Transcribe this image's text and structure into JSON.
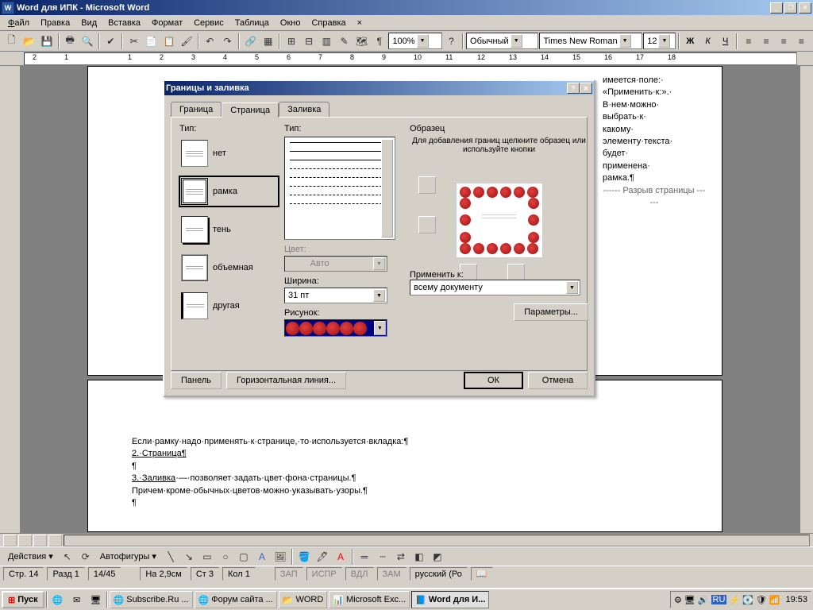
{
  "app": {
    "title": "Word для ИПК - Microsoft Word"
  },
  "menu": {
    "file": "Файл",
    "edit": "Правка",
    "view": "Вид",
    "insert": "Вставка",
    "format": "Формат",
    "tools": "Сервис",
    "table": "Таблица",
    "window": "Окно",
    "help": "Справка"
  },
  "toolbar": {
    "zoom": "100%",
    "style": "Обычный",
    "font": "Times New Roman",
    "size": "12",
    "bold": "Ж",
    "italic": "К",
    "underline": "Ч"
  },
  "ruler": {
    "marks": [
      "2",
      "1",
      "",
      "1",
      "2",
      "3",
      "4",
      "5",
      "6",
      "7",
      "8",
      "9",
      "10",
      "11",
      "12",
      "13",
      "14",
      "15",
      "16",
      "17",
      "18"
    ]
  },
  "doc": {
    "side": [
      "имеется·поле:·",
      "«Применить·к:».·",
      "В·нем·можно·",
      "выбрать·к·",
      "какому·",
      "элементу·текста·",
      "будет·",
      "применена·",
      "рамка.¶"
    ],
    "break": "Разрыв страницы",
    "body": [
      "Если·рамку·надо·применять·к·странице,·то·используется·вкладка:¶",
      "2.·Страница¶",
      "¶",
      "3.·Заливка·—·позволяет·задать·цвет·фона·страницы.¶",
      "Причем·кроме·обычных·цветов·можно·указывать·узоры.¶",
      "        ¶"
    ]
  },
  "dialog": {
    "title": "Границы и заливка",
    "tabs": {
      "border": "Граница",
      "page": "Страница",
      "fill": "Заливка"
    },
    "type_label": "Тип:",
    "types": {
      "none": "нет",
      "box": "рамка",
      "shadow": "тень",
      "threeD": "объемная",
      "custom": "другая"
    },
    "style_label": "Тип:",
    "color_label": "Цвет:",
    "color_value": "Авто",
    "width_label": "Ширина:",
    "width_value": "31 пт",
    "art_label": "Рисунок:",
    "preview_label": "Образец",
    "preview_hint": "Для добавления границ щелкните образец или используйте кнопки",
    "apply_label": "Применить к:",
    "apply_value": "всему документу",
    "options": "Параметры...",
    "panel": "Панель",
    "hline": "Горизонтальная линия...",
    "ok": "ОК",
    "cancel": "Отмена"
  },
  "draw": {
    "actions": "Действия",
    "autoshapes": "Автофигуры"
  },
  "status": {
    "page": "Стр. 14",
    "section": "Разд 1",
    "pages": "14/45",
    "pos": "На 2,9см",
    "line": "Ст 3",
    "col": "Кол 1",
    "rec": "ЗАП",
    "trk": "ИСПР",
    "ext": "ВДЛ",
    "ovr": "ЗАМ",
    "lang": "русский (Ро"
  },
  "taskbar": {
    "start": "Пуск",
    "tasks": [
      "Subscribe.Ru ...",
      "Форум сайта ...",
      "WORD",
      "Microsoft Exc...",
      "Word для И..."
    ],
    "clock": "19:53"
  }
}
